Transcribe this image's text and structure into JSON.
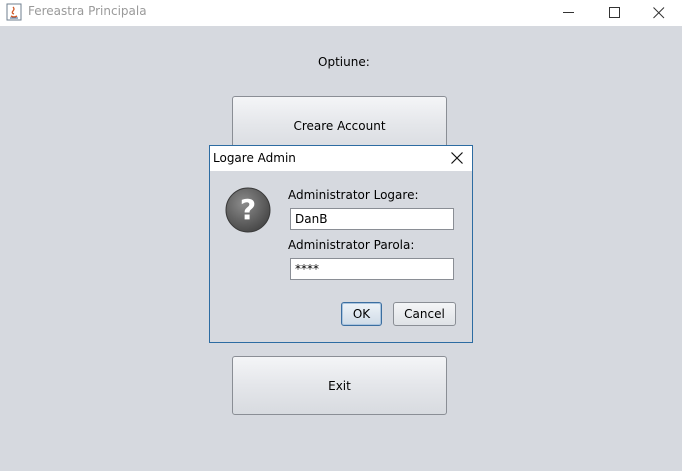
{
  "window": {
    "title": "Fereastra Principala"
  },
  "main": {
    "option_label": "Optiune:",
    "create_account_label": "Creare Account",
    "exit_label": "Exit"
  },
  "dialog": {
    "title": "Logare Admin",
    "user_label": "Administrator Logare:",
    "user_value": "DanB",
    "pass_label": "Administrator Parola:",
    "pass_value": "****",
    "ok_label": "OK",
    "cancel_label": "Cancel",
    "icon": "question-icon"
  },
  "colors": {
    "background": "#d6d9df",
    "dialog_border": "#2d6ca2"
  }
}
